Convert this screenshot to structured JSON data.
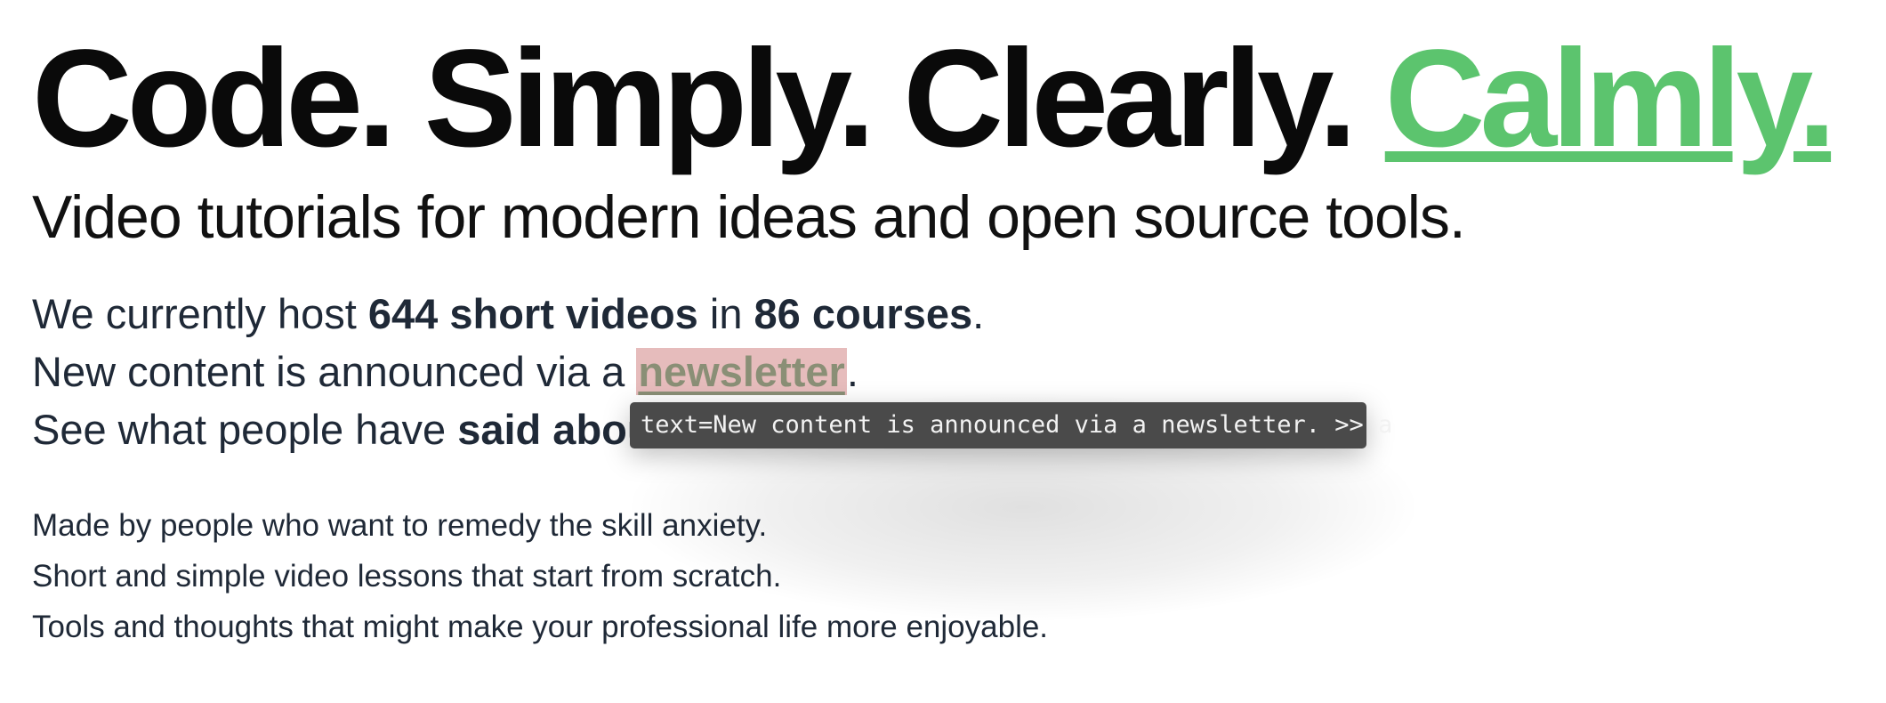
{
  "hero": {
    "headline_main": "Code. Simply. Clearly.",
    "headline_accent": "Calmly.",
    "tagline": "Video tutorials for modern ideas and open source tools."
  },
  "stats": {
    "line1_prefix": "We currently host ",
    "videos": "644 short videos",
    "line1_mid": " in ",
    "courses": "86 courses",
    "line1_suffix": ".",
    "line2_prefix": "New content is announced via a ",
    "newsletter_link": "newsletter",
    "line2_suffix": ".",
    "line3_prefix": "See what people have ",
    "said_link": "said abou"
  },
  "about": {
    "line1": "Made by people who want to remedy the skill anxiety.",
    "line2": "Short and simple video lessons that start from scratch.",
    "line3": "Tools and thoughts that might make your professional life more enjoyable."
  },
  "tooltip": {
    "text": "text=New content is announced via a newsletter. >> a"
  },
  "colors": {
    "accent": "#5cc46e",
    "highlight": "#e6bcbc",
    "tooltip_bg": "#4a4a4a",
    "body_text": "#1f2937"
  }
}
